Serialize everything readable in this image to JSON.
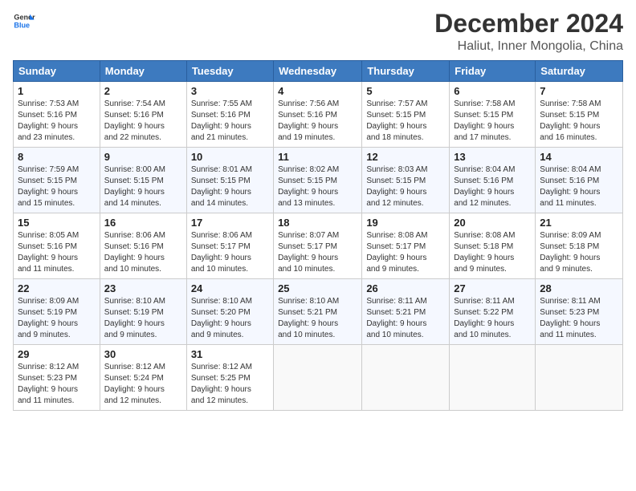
{
  "logo": {
    "text_general": "General",
    "text_blue": "Blue"
  },
  "header": {
    "month": "December 2024",
    "location": "Haliut, Inner Mongolia, China"
  },
  "days_of_week": [
    "Sunday",
    "Monday",
    "Tuesday",
    "Wednesday",
    "Thursday",
    "Friday",
    "Saturday"
  ],
  "weeks": [
    [
      {
        "day": "1",
        "sunrise": "7:53 AM",
        "sunset": "5:16 PM",
        "daylight": "9 hours and 23 minutes."
      },
      {
        "day": "2",
        "sunrise": "7:54 AM",
        "sunset": "5:16 PM",
        "daylight": "9 hours and 22 minutes."
      },
      {
        "day": "3",
        "sunrise": "7:55 AM",
        "sunset": "5:16 PM",
        "daylight": "9 hours and 21 minutes."
      },
      {
        "day": "4",
        "sunrise": "7:56 AM",
        "sunset": "5:16 PM",
        "daylight": "9 hours and 19 minutes."
      },
      {
        "day": "5",
        "sunrise": "7:57 AM",
        "sunset": "5:15 PM",
        "daylight": "9 hours and 18 minutes."
      },
      {
        "day": "6",
        "sunrise": "7:58 AM",
        "sunset": "5:15 PM",
        "daylight": "9 hours and 17 minutes."
      },
      {
        "day": "7",
        "sunrise": "7:58 AM",
        "sunset": "5:15 PM",
        "daylight": "9 hours and 16 minutes."
      }
    ],
    [
      {
        "day": "8",
        "sunrise": "7:59 AM",
        "sunset": "5:15 PM",
        "daylight": "9 hours and 15 minutes."
      },
      {
        "day": "9",
        "sunrise": "8:00 AM",
        "sunset": "5:15 PM",
        "daylight": "9 hours and 14 minutes."
      },
      {
        "day": "10",
        "sunrise": "8:01 AM",
        "sunset": "5:15 PM",
        "daylight": "9 hours and 14 minutes."
      },
      {
        "day": "11",
        "sunrise": "8:02 AM",
        "sunset": "5:15 PM",
        "daylight": "9 hours and 13 minutes."
      },
      {
        "day": "12",
        "sunrise": "8:03 AM",
        "sunset": "5:15 PM",
        "daylight": "9 hours and 12 minutes."
      },
      {
        "day": "13",
        "sunrise": "8:04 AM",
        "sunset": "5:16 PM",
        "daylight": "9 hours and 12 minutes."
      },
      {
        "day": "14",
        "sunrise": "8:04 AM",
        "sunset": "5:16 PM",
        "daylight": "9 hours and 11 minutes."
      }
    ],
    [
      {
        "day": "15",
        "sunrise": "8:05 AM",
        "sunset": "5:16 PM",
        "daylight": "9 hours and 11 minutes."
      },
      {
        "day": "16",
        "sunrise": "8:06 AM",
        "sunset": "5:16 PM",
        "daylight": "9 hours and 10 minutes."
      },
      {
        "day": "17",
        "sunrise": "8:06 AM",
        "sunset": "5:17 PM",
        "daylight": "9 hours and 10 minutes."
      },
      {
        "day": "18",
        "sunrise": "8:07 AM",
        "sunset": "5:17 PM",
        "daylight": "9 hours and 10 minutes."
      },
      {
        "day": "19",
        "sunrise": "8:08 AM",
        "sunset": "5:17 PM",
        "daylight": "9 hours and 9 minutes."
      },
      {
        "day": "20",
        "sunrise": "8:08 AM",
        "sunset": "5:18 PM",
        "daylight": "9 hours and 9 minutes."
      },
      {
        "day": "21",
        "sunrise": "8:09 AM",
        "sunset": "5:18 PM",
        "daylight": "9 hours and 9 minutes."
      }
    ],
    [
      {
        "day": "22",
        "sunrise": "8:09 AM",
        "sunset": "5:19 PM",
        "daylight": "9 hours and 9 minutes."
      },
      {
        "day": "23",
        "sunrise": "8:10 AM",
        "sunset": "5:19 PM",
        "daylight": "9 hours and 9 minutes."
      },
      {
        "day": "24",
        "sunrise": "8:10 AM",
        "sunset": "5:20 PM",
        "daylight": "9 hours and 9 minutes."
      },
      {
        "day": "25",
        "sunrise": "8:10 AM",
        "sunset": "5:21 PM",
        "daylight": "9 hours and 10 minutes."
      },
      {
        "day": "26",
        "sunrise": "8:11 AM",
        "sunset": "5:21 PM",
        "daylight": "9 hours and 10 minutes."
      },
      {
        "day": "27",
        "sunrise": "8:11 AM",
        "sunset": "5:22 PM",
        "daylight": "9 hours and 10 minutes."
      },
      {
        "day": "28",
        "sunrise": "8:11 AM",
        "sunset": "5:23 PM",
        "daylight": "9 hours and 11 minutes."
      }
    ],
    [
      {
        "day": "29",
        "sunrise": "8:12 AM",
        "sunset": "5:23 PM",
        "daylight": "9 hours and 11 minutes."
      },
      {
        "day": "30",
        "sunrise": "8:12 AM",
        "sunset": "5:24 PM",
        "daylight": "9 hours and 12 minutes."
      },
      {
        "day": "31",
        "sunrise": "8:12 AM",
        "sunset": "5:25 PM",
        "daylight": "9 hours and 12 minutes."
      },
      null,
      null,
      null,
      null
    ]
  ],
  "labels": {
    "sunrise": "Sunrise: ",
    "sunset": "Sunset: ",
    "daylight": "Daylight: "
  }
}
